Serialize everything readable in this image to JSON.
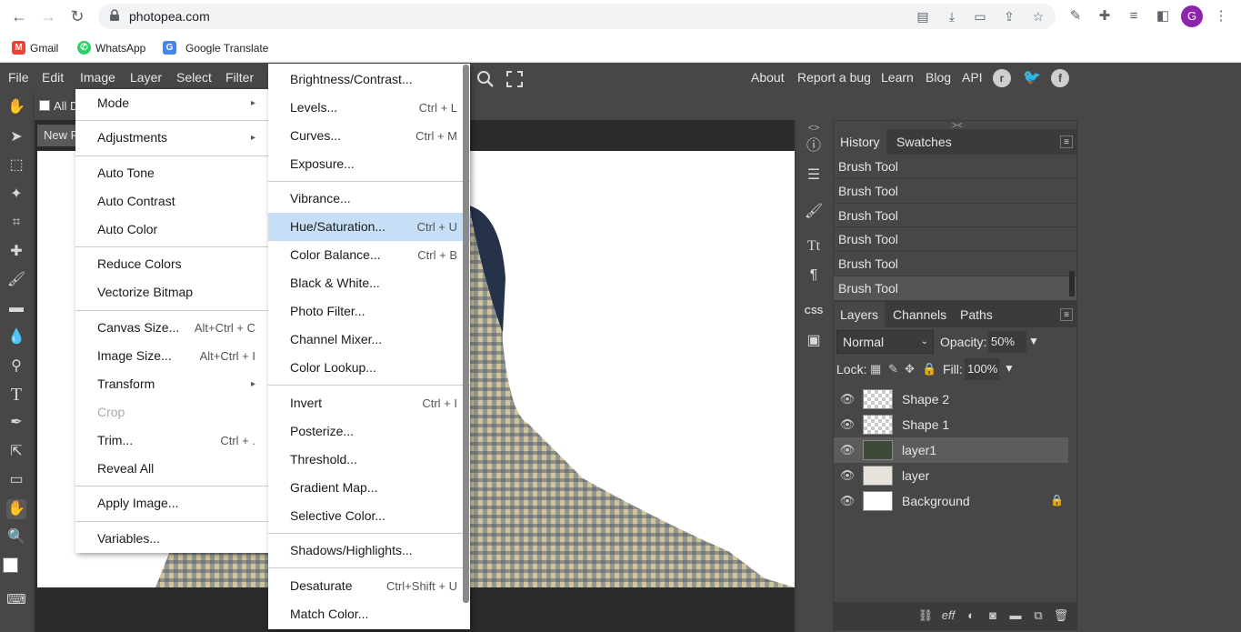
{
  "browser": {
    "url": "photopea.com",
    "avatar_letter": "G",
    "bookmarks": [
      "Gmail",
      "WhatsApp",
      "Google Translate"
    ]
  },
  "app": {
    "menus": [
      "File",
      "Edit",
      "Image",
      "Layer",
      "Select",
      "Filter"
    ],
    "right_links": [
      "About",
      "Report a bug",
      "Learn",
      "Blog",
      "API"
    ],
    "options_checkbox_label": "All D",
    "doc_tab": "New P"
  },
  "image_menu": [
    {
      "label": "Mode",
      "shortcut": "",
      "submenu": true
    },
    {
      "label": "Adjustments",
      "shortcut": "",
      "submenu": true
    },
    {
      "label": "Auto Tone",
      "shortcut": ""
    },
    {
      "label": "Auto Contrast",
      "shortcut": ""
    },
    {
      "label": "Auto Color",
      "shortcut": ""
    },
    {
      "label": "Reduce Colors",
      "shortcut": ""
    },
    {
      "label": "Vectorize Bitmap",
      "shortcut": ""
    },
    {
      "label": "Canvas Size...",
      "shortcut": "Alt+Ctrl + C"
    },
    {
      "label": "Image Size...",
      "shortcut": "Alt+Ctrl + I"
    },
    {
      "label": "Transform",
      "shortcut": "",
      "submenu": true
    },
    {
      "label": "Crop",
      "shortcut": "",
      "disabled": true
    },
    {
      "label": "Trim...",
      "shortcut": "Ctrl + ."
    },
    {
      "label": "Reveal All",
      "shortcut": ""
    },
    {
      "label": "Apply Image...",
      "shortcut": ""
    },
    {
      "label": "Variables...",
      "shortcut": ""
    }
  ],
  "adjustments_menu": [
    {
      "label": "Brightness/Contrast...",
      "shortcut": ""
    },
    {
      "label": "Levels...",
      "shortcut": "Ctrl + L"
    },
    {
      "label": "Curves...",
      "shortcut": "Ctrl + M"
    },
    {
      "label": "Exposure...",
      "shortcut": ""
    },
    {
      "label": "Vibrance...",
      "shortcut": ""
    },
    {
      "label": "Hue/Saturation...",
      "shortcut": "Ctrl + U"
    },
    {
      "label": "Color Balance...",
      "shortcut": "Ctrl + B"
    },
    {
      "label": "Black & White...",
      "shortcut": ""
    },
    {
      "label": "Photo Filter...",
      "shortcut": ""
    },
    {
      "label": "Channel Mixer...",
      "shortcut": ""
    },
    {
      "label": "Color Lookup...",
      "shortcut": ""
    },
    {
      "label": "Invert",
      "shortcut": "Ctrl + I"
    },
    {
      "label": "Posterize...",
      "shortcut": ""
    },
    {
      "label": "Threshold...",
      "shortcut": ""
    },
    {
      "label": "Gradient Map...",
      "shortcut": ""
    },
    {
      "label": "Selective Color...",
      "shortcut": ""
    },
    {
      "label": "Shadows/Highlights...",
      "shortcut": ""
    },
    {
      "label": "Desaturate",
      "shortcut": "Ctrl+Shift + U"
    },
    {
      "label": "Match Color...",
      "shortcut": ""
    }
  ],
  "history_panel": {
    "tabs": [
      "History",
      "Swatches"
    ],
    "items": [
      "Brush Tool",
      "Brush Tool",
      "Brush Tool",
      "Brush Tool",
      "Brush Tool",
      "Brush Tool"
    ]
  },
  "layers_panel": {
    "tabs": [
      "Layers",
      "Channels",
      "Paths"
    ],
    "blend_mode": "Normal",
    "opacity_label": "Opacity:",
    "opacity_value": "50%",
    "lock_label": "Lock:",
    "fill_label": "Fill:",
    "fill_value": "100%",
    "layers": [
      "Shape 2",
      "Shape 1",
      "layer1",
      "layer",
      "Background"
    ]
  },
  "side_icons": {
    "css_label": "CSS"
  },
  "colors": {
    "accent_highlight": "#c6dff6",
    "panel_bg": "#474747"
  }
}
